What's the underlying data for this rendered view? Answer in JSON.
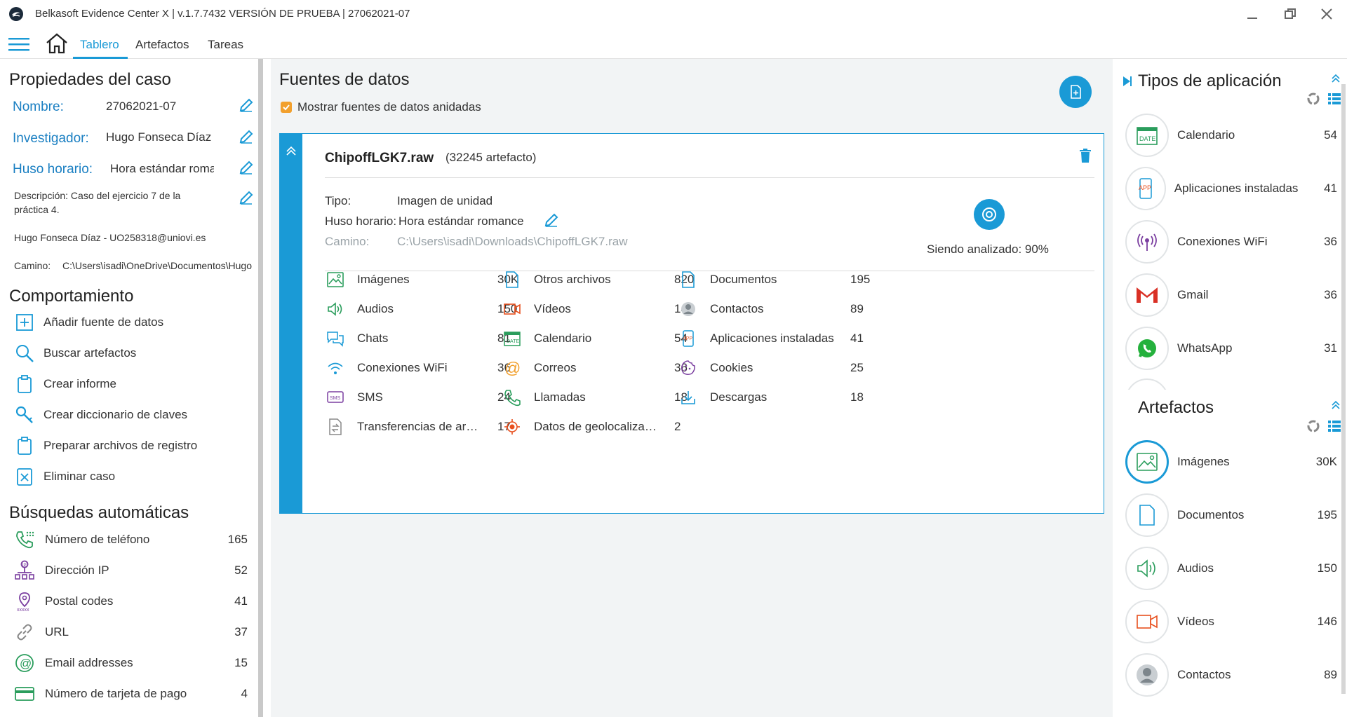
{
  "window": {
    "title": "Belkasoft Evidence Center X | v.1.7.7432 VERSIÓN DE PRUEBA | 27062021-07"
  },
  "nav": {
    "tabs": [
      "Tablero",
      "Artefactos",
      "Tareas"
    ]
  },
  "case_properties": {
    "heading": "Propiedades del caso",
    "name_label": "Nombre:",
    "name_value": "27062021-07",
    "investigator_label": "Investigador:",
    "investigator_value": "Hugo Fonseca Díaz",
    "timezone_label": "Huso horario:",
    "timezone_value": "Hora estándar romance",
    "description": "Descripción: Caso del ejercicio 7 de la práctica 4.",
    "author": "Hugo Fonseca Díaz - UO258318@uniovi.es",
    "path_label": "Camino:",
    "path_value": "C:\\Users\\isadi\\OneDrive\\Documentos\\Hugo"
  },
  "behavior": {
    "heading": "Comportamiento",
    "actions": [
      "Añadir fuente de datos",
      "Buscar artefactos",
      "Crear informe",
      "Crear diccionario de claves",
      "Preparar archivos de registro",
      "Eliminar caso"
    ]
  },
  "auto_searches": {
    "heading": "Búsquedas automáticas",
    "items": [
      {
        "label": "Número de teléfono",
        "count": "165"
      },
      {
        "label": "Dirección IP",
        "count": "52"
      },
      {
        "label": "Postal codes",
        "count": "41"
      },
      {
        "label": "URL",
        "count": "37"
      },
      {
        "label": "Email addresses",
        "count": "15"
      },
      {
        "label": "Número de tarjeta de pago",
        "count": "4"
      }
    ]
  },
  "data_sources": {
    "heading": "Fuentes de datos",
    "show_nested_label": "Mostrar fuentes de datos anidadas",
    "source": {
      "name": "ChipoffLGK7.raw",
      "artifact_count": "(32245 artefacto)",
      "type_label": "Tipo:",
      "type_value": "Imagen de unidad",
      "timezone_label": "Huso horario:",
      "timezone_value": "Hora estándar romance",
      "path_label": "Camino:",
      "path_value": "C:\\Users\\isadi\\Downloads\\ChipoffLGK7.raw",
      "status": "Siendo analizado:  90%",
      "categories": [
        {
          "label": "Imágenes",
          "count": "30K",
          "icon": "image-icon"
        },
        {
          "label": "Otros archivos",
          "count": "820",
          "icon": "file-icon"
        },
        {
          "label": "Documentos",
          "count": "195",
          "icon": "document-icon"
        },
        {
          "label": "Audios",
          "count": "150",
          "icon": "speaker-icon"
        },
        {
          "label": "Vídeos",
          "count": "146",
          "icon": "video-icon"
        },
        {
          "label": "Contactos",
          "count": "89",
          "icon": "contact-icon"
        },
        {
          "label": "Chats",
          "count": "81",
          "icon": "chat-icon"
        },
        {
          "label": "Calendario",
          "count": "54",
          "icon": "calendar-icon"
        },
        {
          "label": "Aplicaciones instaladas",
          "count": "41",
          "icon": "app-icon"
        },
        {
          "label": "Conexiones WiFi",
          "count": "36",
          "icon": "wifi-icon"
        },
        {
          "label": "Correos",
          "count": "36",
          "icon": "at-icon"
        },
        {
          "label": "Cookies",
          "count": "25",
          "icon": "cookie-icon"
        },
        {
          "label": "SMS",
          "count": "24",
          "icon": "sms-icon"
        },
        {
          "label": "Llamadas",
          "count": "18",
          "icon": "phone-icon"
        },
        {
          "label": "Descargas",
          "count": "18",
          "icon": "download-icon"
        },
        {
          "label": "Transferencias de arch...",
          "count": "17",
          "icon": "transfer-icon"
        },
        {
          "label": "Datos de geolocalizac...",
          "count": "2",
          "icon": "geolocation-icon"
        }
      ]
    }
  },
  "app_types": {
    "heading": "Tipos de aplicación",
    "items": [
      {
        "label": "Calendario",
        "count": "54",
        "icon": "calendar-icon"
      },
      {
        "label": "Aplicaciones instaladas",
        "count": "41",
        "icon": "app-icon"
      },
      {
        "label": "Conexiones WiFi",
        "count": "36",
        "icon": "wifi-icon"
      },
      {
        "label": "Gmail",
        "count": "36",
        "icon": "gmail-icon"
      },
      {
        "label": "WhatsApp",
        "count": "31",
        "icon": "whatsapp-icon"
      }
    ]
  },
  "artifacts": {
    "heading": "Artefactos",
    "items": [
      {
        "label": "Imágenes",
        "count": "30K",
        "icon": "image-icon"
      },
      {
        "label": "Documentos",
        "count": "195",
        "icon": "document-icon"
      },
      {
        "label": "Audios",
        "count": "150",
        "icon": "speaker-icon"
      },
      {
        "label": "Vídeos",
        "count": "146",
        "icon": "video-icon"
      },
      {
        "label": "Contactos",
        "count": "89",
        "icon": "contact-icon"
      }
    ]
  },
  "colors": {
    "accent": "#1a9ad6",
    "checkbox": "#f2a02d",
    "label_blue": "#1a7fc2",
    "gmail_red": "#d93025",
    "whatsapp_green": "#25b13d",
    "geolocation_orange": "#e8501e"
  }
}
